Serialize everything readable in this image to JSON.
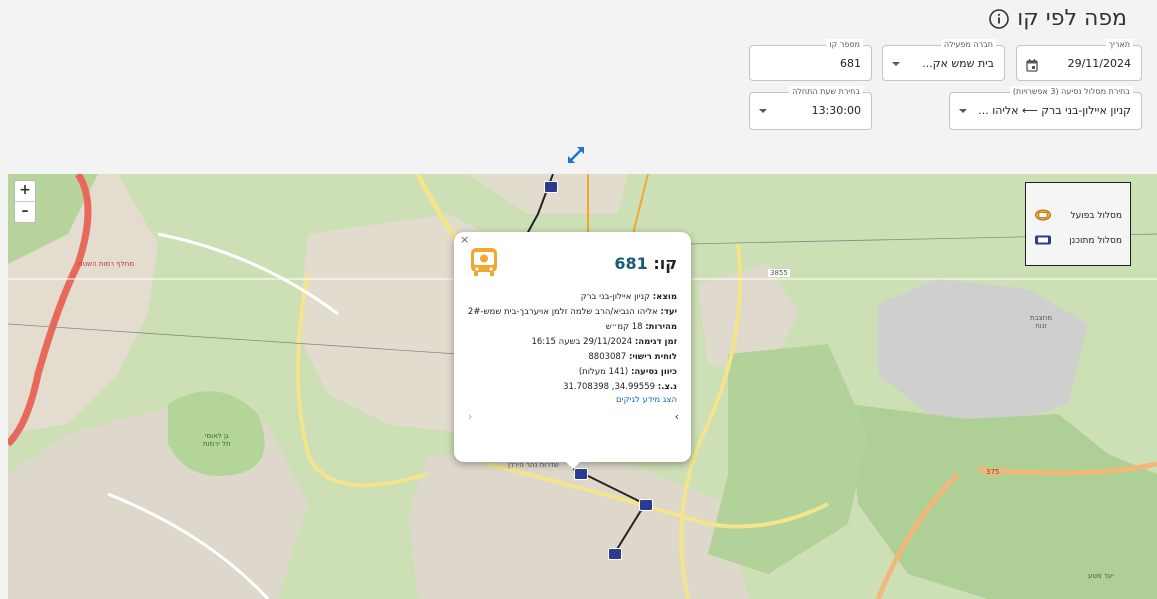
{
  "page": {
    "title": "מפה לפי קו"
  },
  "filters": {
    "date": {
      "label": "תאריך",
      "value": "29/11/2024"
    },
    "operator": {
      "label": "חברה מפעילה",
      "value": "בית שמש אק..."
    },
    "line_number": {
      "label": "מספר קו",
      "value": "681"
    },
    "route": {
      "label": "בחירת מסלול נסיעה (3 אפשרויות)",
      "value": "קניון איילון-בני ברק ⟵ אליהו ..."
    },
    "start_time": {
      "label": "בחירת שעת התחלה",
      "value": "13:30:00"
    }
  },
  "map": {
    "zoom_in": "+",
    "zoom_out": "–",
    "legend": [
      {
        "label": "מסלול בפועל",
        "icon": "actual-route-icon",
        "color": "#f0a830"
      },
      {
        "label": "מסלול מתוכנן",
        "icon": "planned-route-icon",
        "color": "#2c3b8f"
      }
    ],
    "labels": {
      "forest": "גן לאומי\nתל ירמות",
      "quarry": "מחצבת\nזנוח",
      "road_num1": "3855",
      "road_num2": "375",
      "area": "יער מטע",
      "street1": "מחלף רמות השטח",
      "street2": "שדרות נהר הירדן"
    }
  },
  "popup": {
    "close": "×",
    "line_prefix": "קו:",
    "line_number": "681",
    "rows": [
      {
        "key": "מוצא:",
        "value": "קניון איילון-בני ברק"
      },
      {
        "key": "יעד:",
        "value": "אליהו הנביא/הרב שלמה זלמן אויערבך-בית שמש-2#"
      },
      {
        "key": "מהירות:",
        "value": "18 קמ״ש"
      },
      {
        "key": "זמן דגימה:",
        "value": "29/11/2024 בשעה 16:15"
      },
      {
        "key": "לוחית רישוי:",
        "value": "8803087"
      },
      {
        "key": "כיוון נסיעה:",
        "value": "(141 מעלות)"
      },
      {
        "key": "נ.צ.:",
        "value": "34.99559, 31.708398"
      }
    ],
    "link": "הצג מידע לגיקים",
    "prev": "‹",
    "next": "›"
  },
  "colors": {
    "accent": "#1976d2",
    "actual_route": "#f0a830",
    "planned_route": "#2c3b8f",
    "line_number": "#1a5a78"
  }
}
